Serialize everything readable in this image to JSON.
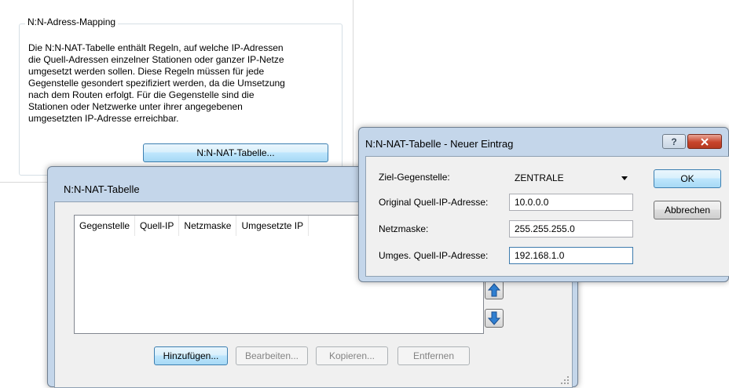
{
  "background_page": {
    "group_title": "N:N-Adress-Mapping",
    "description": "Die N:N-NAT-Tabelle enthält Regeln, auf welche IP-Adressen\ndie Quell-Adressen einzelner Stationen oder ganzer IP-Netze\numgesetzt werden sollen. Diese Regeln müssen für jede\nGegenstelle gesondert spezifiziert werden, da die Umsetzung\nnach dem Routen erfolgt. Für die Gegenstelle sind die\nStationen oder Netzwerke unter ihrer angegebenen\numgesetzten IP-Adresse erreichbar.",
    "open_table_button": "N:N-NAT-Tabelle..."
  },
  "table_window": {
    "title": "N:N-NAT-Tabelle",
    "columns": [
      "Gegenstelle",
      "Quell-IP",
      "Netzmaske",
      "Umgesetzte IP"
    ],
    "rows": [],
    "buttons": {
      "add": "Hinzufügen...",
      "edit": "Bearbeiten...",
      "copy": "Kopieren...",
      "remove": "Entfernen"
    },
    "icons": [
      "arrow-up-icon",
      "arrow-down-icon",
      "resize-grip-icon"
    ]
  },
  "dialog": {
    "title": "N:N-NAT-Tabelle - Neuer Eintrag",
    "help_glyph": "?",
    "fields": {
      "target": {
        "label": "Ziel-Gegenstelle:",
        "value": "ZENTRALE"
      },
      "source_ip": {
        "label": "Original Quell-IP-Adresse:",
        "value": "10.0.0.0"
      },
      "netmask": {
        "label": "Netzmaske:",
        "value": "255.255.255.0"
      },
      "mapped_ip": {
        "label": "Umges. Quell-IP-Adresse:",
        "value": "192.168.1.0"
      }
    },
    "ok_label": "OK",
    "cancel_label": "Abbrechen"
  },
  "colors": {
    "window_frame": "#c4d6ea",
    "client_bg": "#f0f0f0",
    "arrow_blue": "#2f7fd1",
    "close_red": "#c8452c",
    "default_button_border": "#3c7fb1"
  }
}
